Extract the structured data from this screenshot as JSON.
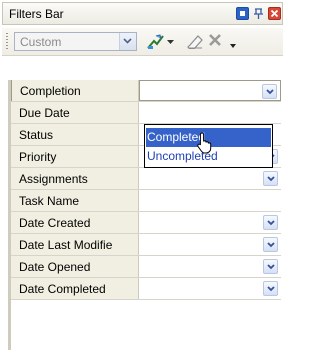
{
  "window": {
    "title": "Filters Bar"
  },
  "toolbar": {
    "preset_value": "Custom"
  },
  "filter_rows": [
    {
      "label": "Completion",
      "value": "",
      "has_dropdown": true
    },
    {
      "label": "Due Date",
      "value": "",
      "has_dropdown": false
    },
    {
      "label": "Status",
      "value": "",
      "has_dropdown": false
    },
    {
      "label": "Priority",
      "value": "",
      "has_dropdown": true
    },
    {
      "label": "Assignments",
      "value": "",
      "has_dropdown": true
    },
    {
      "label": "Task Name",
      "value": "",
      "has_dropdown": false
    },
    {
      "label": "Date Created",
      "value": "",
      "has_dropdown": true
    },
    {
      "label": "Date Last Modifie",
      "value": "",
      "has_dropdown": true
    },
    {
      "label": "Date Opened",
      "value": "",
      "has_dropdown": true
    },
    {
      "label": "Date Completed",
      "value": "",
      "has_dropdown": true
    }
  ],
  "completion_dropdown": {
    "options": [
      "Completed",
      "Uncompleted"
    ],
    "highlighted": "Completed"
  },
  "colors": {
    "highlight": "#3563c9",
    "row_label_bg": "#f1efe2"
  }
}
